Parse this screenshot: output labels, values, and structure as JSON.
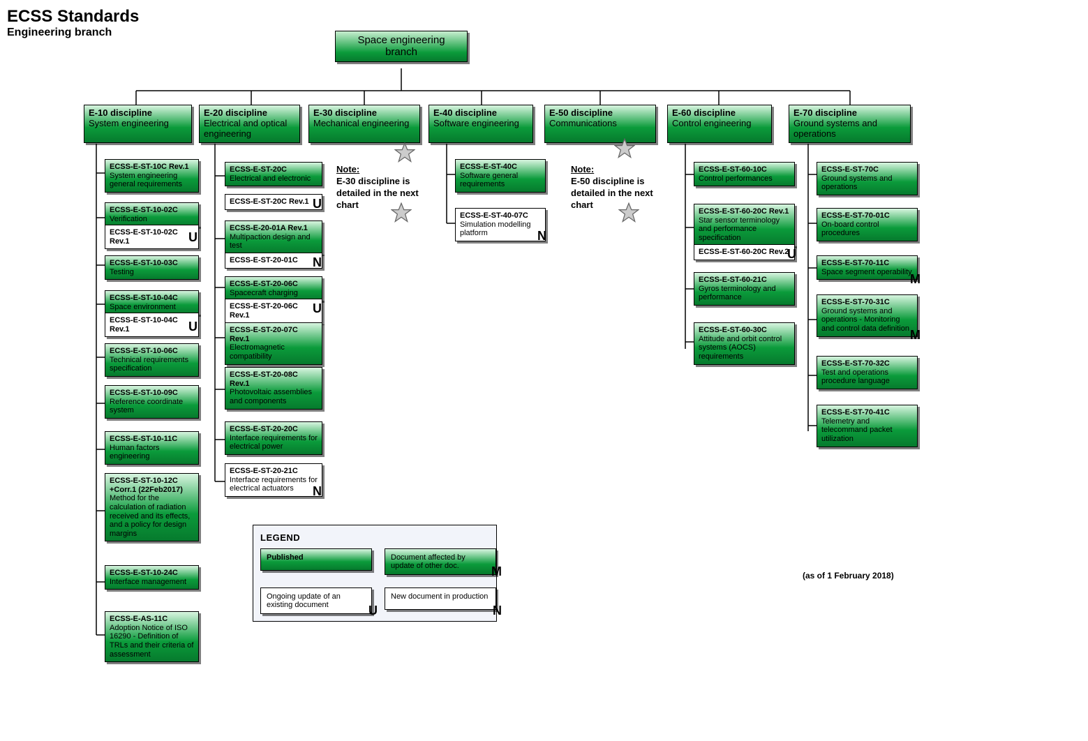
{
  "header": {
    "title": "ECSS Standards",
    "subtitle": "Engineering branch"
  },
  "root": {
    "line1": "Space engineering",
    "line2": "branch"
  },
  "disciplines": {
    "e10": {
      "title": "E-10 discipline",
      "subtitle": "System engineering"
    },
    "e20": {
      "title": "E-20 discipline",
      "subtitle": "Electrical and optical engineering"
    },
    "e30": {
      "title": "E-30 discipline",
      "subtitle": "Mechanical engineering"
    },
    "e40": {
      "title": "E-40 discipline",
      "subtitle": "Software engineering"
    },
    "e50": {
      "title": "E-50 discipline",
      "subtitle": "Communications"
    },
    "e60": {
      "title": "E-60 discipline",
      "subtitle": "Control engineering"
    },
    "e70": {
      "title": "E-70 discipline",
      "subtitle": "Ground systems and operations"
    }
  },
  "e10_docs": {
    "d0": {
      "code": "ECSS-E-ST-10C Rev.1",
      "desc": "System engineering general requirements"
    },
    "d1": {
      "code": "ECSS-E-ST-10-02C",
      "desc": "Verification"
    },
    "d1u": {
      "code": "ECSS-E-ST-10-02C Rev.1"
    },
    "d2": {
      "code": "ECSS-E-ST-10-03C",
      "desc": "Testing"
    },
    "d3": {
      "code": "ECSS-E-ST-10-04C",
      "desc": "Space environment"
    },
    "d3u": {
      "code": "ECSS-E-ST-10-04C Rev.1"
    },
    "d4": {
      "code": "ECSS-E-ST-10-06C",
      "desc": "Technical requirements specification"
    },
    "d5": {
      "code": "ECSS-E-ST-10-09C",
      "desc": "Reference coordinate system"
    },
    "d6": {
      "code": "ECSS-E-ST-10-11C",
      "desc": "Human factors engineering"
    },
    "d7": {
      "code": "ECSS-E-ST-10-12C +Corr.1 (22Feb2017)",
      "desc": "Method for the calculation of radiation received and its effects, and a policy for design margins"
    },
    "d8": {
      "code": "ECSS-E-ST-10-24C",
      "desc": "Interface management"
    },
    "d9": {
      "code": "ECSS-E-AS-11C",
      "desc": "Adoption Notice of ISO 16290 - Definition of TRLs and their criteria of assessment"
    }
  },
  "e20_docs": {
    "d0": {
      "code": "ECSS-E-ST-20C",
      "desc": "Electrical and electronic"
    },
    "d0u": {
      "code": "ECSS-E-ST-20C Rev.1"
    },
    "d1": {
      "code": "ECSS-E-20-01A Rev.1",
      "desc": "Multipaction design and test"
    },
    "d1n": {
      "code": "ECSS-E-ST-20-01C"
    },
    "d2": {
      "code": "ECSS-E-ST-20-06C",
      "desc": "Spacecraft charging"
    },
    "d2u": {
      "code": "ECSS-E-ST-20-06C Rev.1"
    },
    "d3": {
      "code": "ECSS-E-ST-20-07C Rev.1",
      "desc": "Electromagnetic compatibility"
    },
    "d4": {
      "code": "ECSS-E-ST-20-08C Rev.1",
      "desc": "Photovoltaic assemblies and components"
    },
    "d5": {
      "code": "ECSS-E-ST-20-20C",
      "desc": "Interface requirements for electrical power"
    },
    "d6": {
      "code": "ECSS-E-ST-20-21C",
      "desc": "Interface requirements for electrical actuators"
    }
  },
  "e40_docs": {
    "d0": {
      "code": "ECSS-E-ST-40C",
      "desc": "Software general requirements"
    },
    "d1": {
      "code": "ECSS-E-ST-40-07C",
      "desc": "Simulation modelling platform"
    }
  },
  "e60_docs": {
    "d0": {
      "code": "ECSS-E-ST-60-10C",
      "desc": "Control performances"
    },
    "d1": {
      "code": "ECSS-E-ST-60-20C Rev.1",
      "desc": "Star sensor terminology and performance specification"
    },
    "d1u": {
      "code": "ECSS-E-ST-60-20C Rev.2"
    },
    "d2": {
      "code": "ECSS-E-ST-60-21C",
      "desc": "Gyros terminology and performance"
    },
    "d3": {
      "code": "ECSS-E-ST-60-30C",
      "desc": "Attitude and orbit control systems (AOCS) requirements"
    }
  },
  "e70_docs": {
    "d0": {
      "code": "ECSS-E-ST-70C",
      "desc": "Ground systems and operations"
    },
    "d1": {
      "code": "ECSS-E-ST-70-01C",
      "desc": "On-board control procedures"
    },
    "d2": {
      "code": "ECSS-E-ST-70-11C",
      "desc": "Space segment operability"
    },
    "d3": {
      "code": "ECSS-E-ST-70-31C",
      "desc": "Ground systems and operations - Monitoring and control data definition"
    },
    "d4": {
      "code": "ECSS-E-ST-70-32C",
      "desc": "Test and operations procedure language"
    },
    "d5": {
      "code": "ECSS-E-ST-70-41C",
      "desc": "Telemetry and telecommand packet utilization"
    }
  },
  "notes": {
    "e30": {
      "head": "Note:",
      "body1": "E-30 discipline is",
      "body2": "detailed in the next",
      "body3": "chart"
    },
    "e50": {
      "head": "Note:",
      "body1": "E-50 discipline is",
      "body2": "detailed in the next",
      "body3": "chart"
    }
  },
  "tags": {
    "U": "U",
    "N": "N",
    "M": "M"
  },
  "legend": {
    "title": "LEGEND",
    "published": "Published",
    "affected": "Document affected by update of other doc.",
    "ongoing": "Ongoing update of an existing document",
    "newdoc": "New document in production"
  },
  "date_note": "(as of 1 February 2018)"
}
